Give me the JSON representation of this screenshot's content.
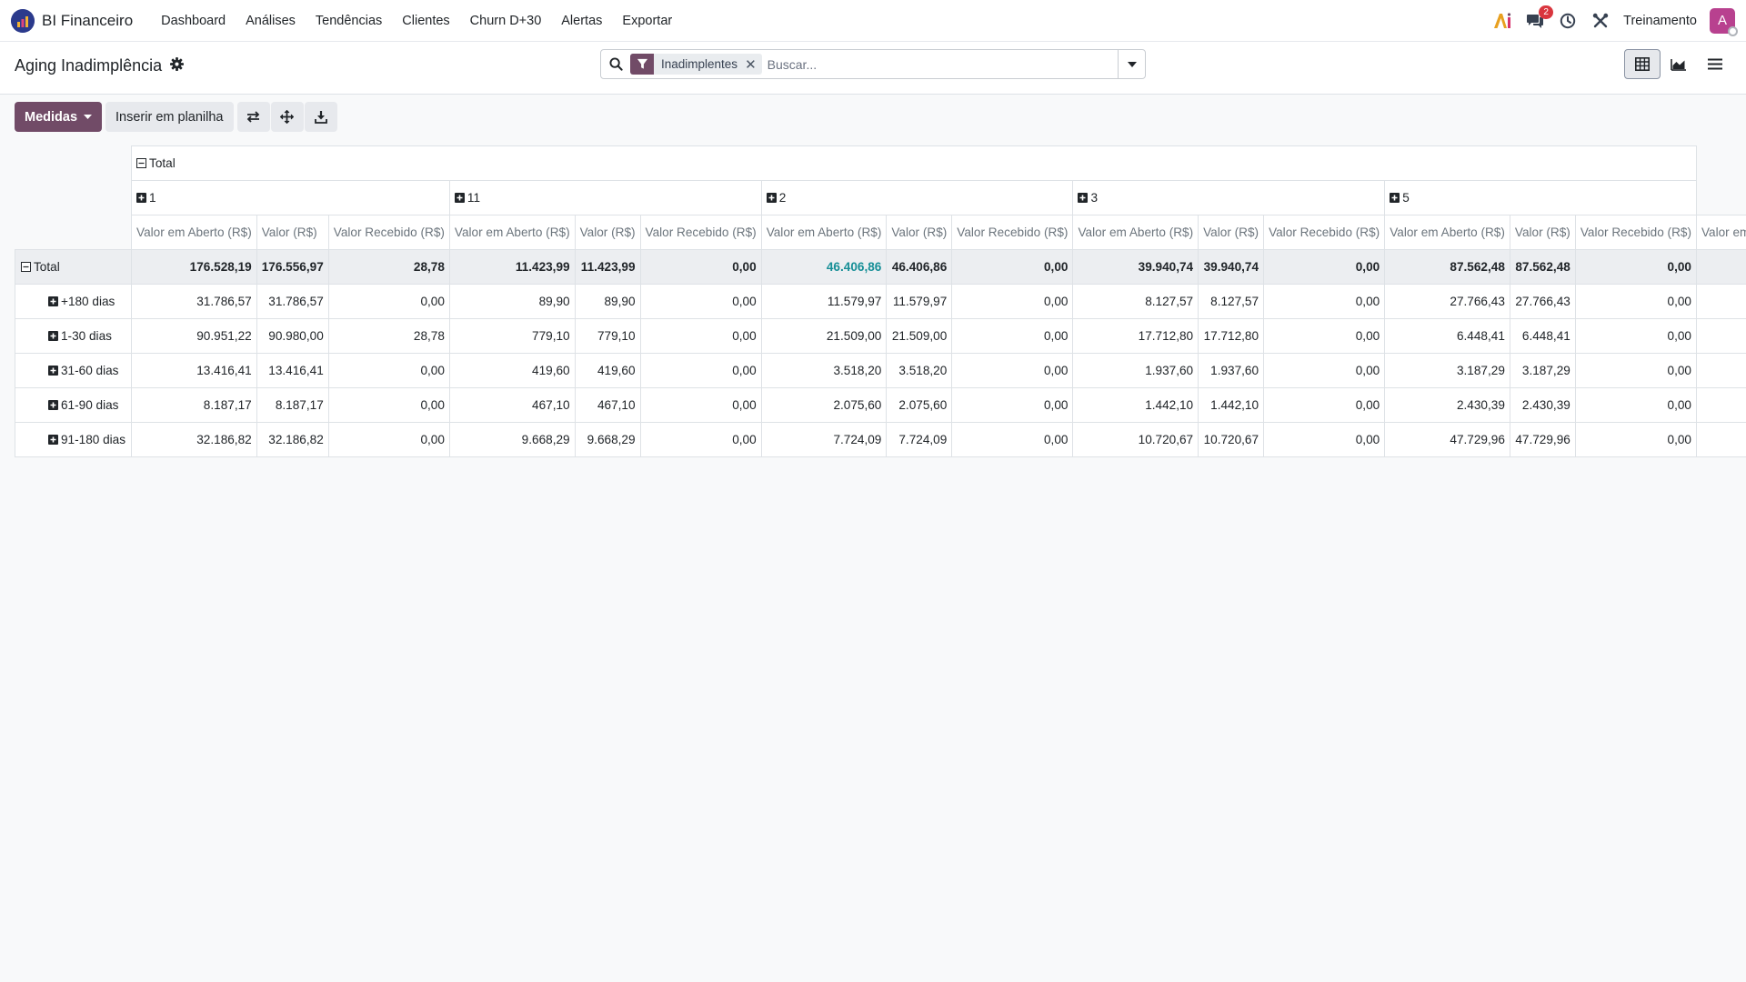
{
  "app": {
    "title": "BI Financeiro",
    "menu": [
      "Dashboard",
      "Análises",
      "Tendências",
      "Clientes",
      "Churn D+30",
      "Alertas",
      "Exportar"
    ],
    "notifications": "2",
    "company": "Treinamento",
    "avatar_letter": "A",
    "accent_color": "#714b67"
  },
  "page": {
    "title": "Aging Inadimplência"
  },
  "search": {
    "facet": "Inadimplentes",
    "placeholder": "Buscar..."
  },
  "toolbar": {
    "measures_label": "Medidas",
    "insert_label": "Inserir em planilha"
  },
  "pivot": {
    "column_total_label": "Total",
    "column_groups": [
      "1",
      "11",
      "2",
      "3",
      "5"
    ],
    "measures": [
      "Valor em Aberto (R$)",
      "Valor (R$)",
      "Valor Recebido (R$)"
    ],
    "partial_measure": "Valor em",
    "rows": [
      {
        "label": "Total",
        "expanded": true,
        "values": [
          "176.528,19",
          "176.556,97",
          "28,78",
          "11.423,99",
          "11.423,99",
          "0,00",
          "46.406,86",
          "46.406,86",
          "0,00",
          "39.940,74",
          "39.940,74",
          "0,00",
          "87.562,48",
          "87.562,48",
          "0,00"
        ]
      },
      {
        "label": "+180 dias",
        "values": [
          "31.786,57",
          "31.786,57",
          "0,00",
          "89,90",
          "89,90",
          "0,00",
          "11.579,97",
          "11.579,97",
          "0,00",
          "8.127,57",
          "8.127,57",
          "0,00",
          "27.766,43",
          "27.766,43",
          "0,00"
        ]
      },
      {
        "label": "1-30 dias",
        "values": [
          "90.951,22",
          "90.980,00",
          "28,78",
          "779,10",
          "779,10",
          "0,00",
          "21.509,00",
          "21.509,00",
          "0,00",
          "17.712,80",
          "17.712,80",
          "0,00",
          "6.448,41",
          "6.448,41",
          "0,00"
        ]
      },
      {
        "label": "31-60 dias",
        "values": [
          "13.416,41",
          "13.416,41",
          "0,00",
          "419,60",
          "419,60",
          "0,00",
          "3.518,20",
          "3.518,20",
          "0,00",
          "1.937,60",
          "1.937,60",
          "0,00",
          "3.187,29",
          "3.187,29",
          "0,00"
        ]
      },
      {
        "label": "61-90 dias",
        "values": [
          "8.187,17",
          "8.187,17",
          "0,00",
          "467,10",
          "467,10",
          "0,00",
          "2.075,60",
          "2.075,60",
          "0,00",
          "1.442,10",
          "1.442,10",
          "0,00",
          "2.430,39",
          "2.430,39",
          "0,00"
        ]
      },
      {
        "label": "91-180 dias",
        "values": [
          "32.186,82",
          "32.186,82",
          "0,00",
          "9.668,29",
          "9.668,29",
          "0,00",
          "7.724,09",
          "7.724,09",
          "0,00",
          "10.720,67",
          "10.720,67",
          "0,00",
          "47.729,96",
          "47.729,96",
          "0,00"
        ]
      }
    ]
  }
}
